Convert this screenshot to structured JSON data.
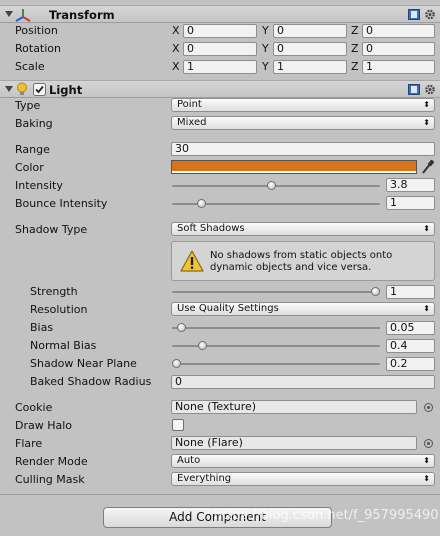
{
  "transform": {
    "title": "Transform",
    "position": {
      "label": "Position",
      "x": "0",
      "y": "0",
      "z": "0"
    },
    "rotation": {
      "label": "Rotation",
      "x": "0",
      "y": "0",
      "z": "0"
    },
    "scale": {
      "label": "Scale",
      "x": "1",
      "y": "1",
      "z": "1"
    },
    "axis_x": "X",
    "axis_y": "Y",
    "axis_z": "Z"
  },
  "light": {
    "title": "Light",
    "type": {
      "label": "Type",
      "value": "Point"
    },
    "baking": {
      "label": "Baking",
      "value": "Mixed"
    },
    "range": {
      "label": "Range",
      "value": "30"
    },
    "color": {
      "label": "Color",
      "value": "#d8731a"
    },
    "intensity": {
      "label": "Intensity",
      "value": "3.8",
      "fraction": 0.475
    },
    "bounce_intensity": {
      "label": "Bounce Intensity",
      "value": "1",
      "fraction": 0.125
    },
    "shadow_type": {
      "label": "Shadow Type",
      "value": "Soft Shadows"
    },
    "warning": {
      "line1": "No shadows from static objects onto",
      "line2": "dynamic objects and vice versa."
    },
    "strength": {
      "label": "Strength",
      "value": "1",
      "fraction": 1.0
    },
    "resolution": {
      "label": "Resolution",
      "value": "Use Quality Settings"
    },
    "bias": {
      "label": "Bias",
      "value": "0.05",
      "fraction": 0.025
    },
    "normal_bias": {
      "label": "Normal Bias",
      "value": "0.4",
      "fraction": 0.133
    },
    "shadow_near_plane": {
      "label": "Shadow Near Plane",
      "value": "0.2",
      "fraction": 0.0
    },
    "baked_shadow_radius": {
      "label": "Baked Shadow Radius",
      "value": "0"
    },
    "cookie": {
      "label": "Cookie",
      "value": "None (Texture)"
    },
    "draw_halo": {
      "label": "Draw Halo",
      "checked": false
    },
    "flare": {
      "label": "Flare",
      "value": "None (Flare)"
    },
    "render_mode": {
      "label": "Render Mode",
      "value": "Auto"
    },
    "culling_mask": {
      "label": "Culling Mask",
      "value": "Everything"
    }
  },
  "add_component": {
    "label": "Add Component"
  },
  "watermark": "https://blog.csdn.net/f_957995490",
  "icons": {
    "transform": "transform-axes-icon",
    "light": "lightbulb-icon",
    "help": "help-book-icon",
    "gear": "gear-icon",
    "eyedropper": "eyedropper-icon",
    "picker": "object-picker-icon",
    "warning": "warning-icon"
  },
  "colors": {
    "accent_orange": "#d8731a",
    "panel": "#c2c2c2"
  }
}
